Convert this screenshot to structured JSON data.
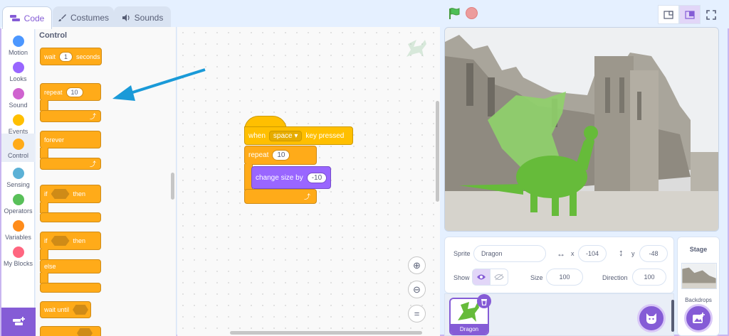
{
  "tabs": [
    {
      "label": "Code",
      "icon": "code-icon"
    },
    {
      "label": "Costumes",
      "icon": "brush-icon"
    },
    {
      "label": "Sounds",
      "icon": "speaker-icon"
    }
  ],
  "categories": [
    {
      "label": "Motion",
      "color": "#4c97ff"
    },
    {
      "label": "Looks",
      "color": "#9966ff"
    },
    {
      "label": "Sound",
      "color": "#cf63cf"
    },
    {
      "label": "Events",
      "color": "#ffbf00"
    },
    {
      "label": "Control",
      "color": "#ffab19"
    },
    {
      "label": "Sensing",
      "color": "#5cb1d6"
    },
    {
      "label": "Operators",
      "color": "#59c059"
    },
    {
      "label": "Variables",
      "color": "#ff8c1a"
    },
    {
      "label": "My Blocks",
      "color": "#ff6680"
    }
  ],
  "palette": {
    "title": "Control",
    "wait": {
      "pre": "wait",
      "value": "1",
      "post": "seconds"
    },
    "repeat": {
      "label": "repeat",
      "value": "10"
    },
    "forever": "forever",
    "if_then": {
      "if": "if",
      "then": "then"
    },
    "if_else": {
      "if": "if",
      "then": "then",
      "else": "else"
    },
    "wait_until": "wait until"
  },
  "script": {
    "hat": {
      "pre": "when",
      "key": "space",
      "post": "key pressed"
    },
    "repeat": {
      "label": "repeat",
      "value": "10"
    },
    "change": {
      "label": "change size by",
      "value": "-10"
    }
  },
  "sprite_info": {
    "sprite_label": "Sprite",
    "sprite_name": "Dragon",
    "x_label": "x",
    "x_value": "-104",
    "y_label": "y",
    "y_value": "-48",
    "show_label": "Show",
    "size_label": "Size",
    "size_value": "100",
    "direction_label": "Direction",
    "direction_value": "100"
  },
  "sprites": [
    {
      "name": "Dragon"
    }
  ],
  "stage_panel": {
    "title": "Stage",
    "backdrops_label": "Backdrops"
  },
  "colors": {
    "accent": "#855cd6",
    "control": "#ffab19",
    "looks": "#9966ff",
    "events": "#ffbf00",
    "arrow": "#1a9ad8"
  }
}
